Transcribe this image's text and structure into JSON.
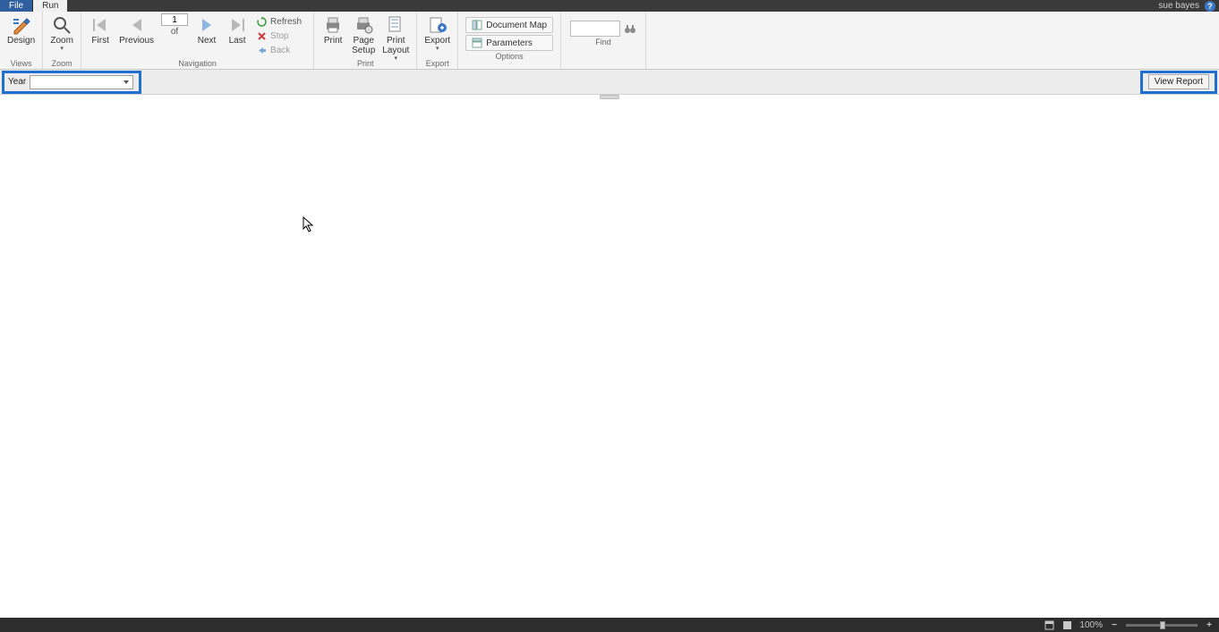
{
  "titlebar": {
    "user": "sue bayes"
  },
  "tabs": {
    "file": "File",
    "run": "Run"
  },
  "ribbon": {
    "views": {
      "design": "Design",
      "group": "Views"
    },
    "zoom": {
      "zoom": "Zoom",
      "group": "Zoom"
    },
    "nav": {
      "first": "First",
      "previous": "Previous",
      "page_value": "1",
      "of": "of",
      "next": "Next",
      "last": "Last",
      "refresh": "Refresh",
      "stop": "Stop",
      "back": "Back",
      "group": "Navigation"
    },
    "print": {
      "print": "Print",
      "page_setup": "Page\nSetup",
      "print_layout": "Print\nLayout",
      "group": "Print"
    },
    "export": {
      "export": "Export",
      "group": "Export"
    },
    "options": {
      "document_map": "Document Map",
      "parameters": "Parameters",
      "group": "Options"
    },
    "find": {
      "group": "Find"
    }
  },
  "params": {
    "year_label": "Year",
    "view_report": "View Report"
  },
  "status": {
    "zoom": "100%"
  }
}
